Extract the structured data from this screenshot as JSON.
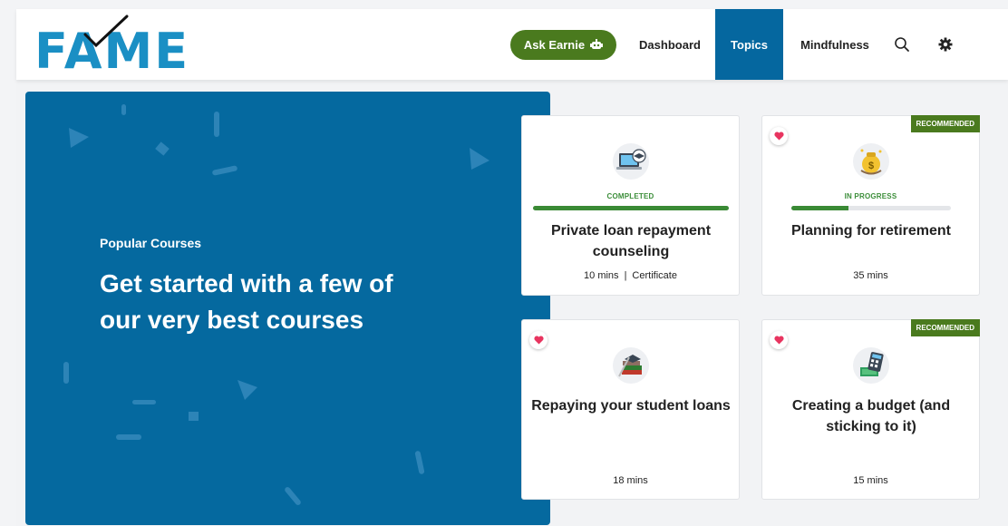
{
  "header": {
    "logo_text": "FAME",
    "ask_label": "Ask Earnie",
    "nav": [
      "Dashboard",
      "Topics",
      "Mindfulness"
    ],
    "active_nav": "Topics",
    "icons": [
      "search-icon",
      "gear-icon"
    ]
  },
  "hero": {
    "subtitle": "Popular Courses",
    "title": "Get started with a few of our very best courses"
  },
  "cards": [
    {
      "status": "COMPLETED",
      "progress": 1.0,
      "title": "Private loan repayment counseling",
      "duration": "10 mins",
      "extra": "Certificate",
      "icon": "laptop-icon"
    },
    {
      "badge": "RECOMMENDED",
      "status": "IN PROGRESS",
      "progress": 0.36,
      "title": "Planning for retirement",
      "duration": "35 mins",
      "icon": "money-bag-icon"
    },
    {
      "title": "Repaying your student loans",
      "duration": "18 mins",
      "icon": "books-icon"
    },
    {
      "badge": "RECOMMENDED",
      "title": "Creating a budget (and sticking to it)",
      "duration": "15 mins",
      "icon": "calculator-icon"
    }
  ],
  "colors": {
    "brand_blue": "#05699f",
    "logo_blue": "#1a8fc4",
    "accent_green": "#4a7a1e",
    "heart_pink": "#e8345f"
  }
}
